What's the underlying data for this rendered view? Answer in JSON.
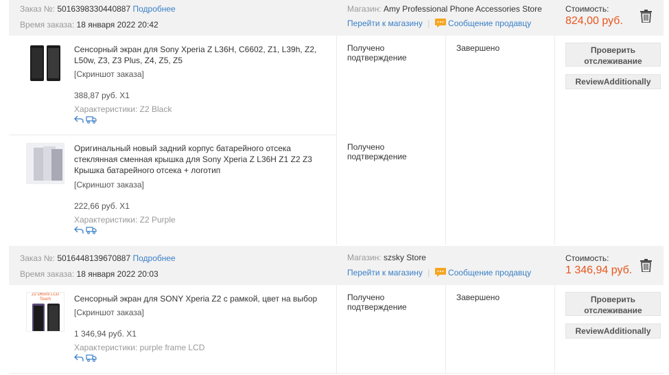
{
  "orders": [
    {
      "order_label": "Заказ №:",
      "order_no": "5016398330440887",
      "details_link": "Подробнее",
      "time_label": "Время заказа:",
      "time_value": "18 января 2022 20:42",
      "store_label": "Магазин:",
      "store_name": "Amy Professional Phone Accessories Store",
      "go_store": "Перейти к магазину",
      "message_seller": "Сообщение продавцу",
      "cost_label": "Стоимость:",
      "cost_value": "824,00 руб.",
      "status": "Завершено",
      "track_button": "Проверить отслеживание",
      "review_button": "ReviewAdditionally",
      "items": [
        {
          "title": "Сенсорный экран для Sony Xperia Z L36H, C6602, Z1, L39h, Z2, L50w, Z3, Z3 Plus, Z4, Z5, Z5",
          "screenshot": "[Скриншот заказа]",
          "price": "388,87 руб. X1",
          "chars_label": "Характеристики:",
          "chars_value": "Z2 Black",
          "confirm": "Получено подтверждение"
        },
        {
          "title": "Оригинальный новый задний корпус батарейного отсека стеклянная сменная крышка для Sony Xperia Z L36H Z1 Z2 Z3 Крышка батарейного отсека + логотип",
          "screenshot": "[Скриншот заказа]",
          "price": "222,66 руб. X1",
          "chars_label": "Характеристики:",
          "chars_value": "Z2 Purple",
          "confirm": "Получено подтверждение"
        }
      ]
    },
    {
      "order_label": "Заказ №:",
      "order_no": "5016448139670887",
      "details_link": "Подробнее",
      "time_label": "Время заказа:",
      "time_value": "18 января 2022 20:03",
      "store_label": "Магазин:",
      "store_name": "szsky Store",
      "go_store": "Перейти к магазину",
      "message_seller": "Сообщение продавцу",
      "cost_label": "Стоимость:",
      "cost_value": "1 346,94 руб.",
      "status": "Завершено",
      "track_button": "Проверить отслеживание",
      "review_button": "ReviewAdditionally",
      "items": [
        {
          "title": "Сенсорный экран для SONY Xperia Z2 с рамкой, цвет на выбор",
          "screenshot": "[Скриншот заказа]",
          "price": "1 346,94 руб. X1",
          "chars_label": "Характеристики:",
          "chars_value": "purple frame LCD",
          "confirm": "Получено подтверждение",
          "thumb_text": "Z2 D6503 LCD Touch"
        }
      ]
    }
  ],
  "icons": {
    "trash": "trash-icon",
    "chat": "chat-icon",
    "return": "return-icon",
    "truck": "truck-icon"
  },
  "colors": {
    "accent_link": "#3a7fc6",
    "price": "#e8551c",
    "chat_icon": "#f5a623",
    "header_bg": "#f2f2f2"
  }
}
